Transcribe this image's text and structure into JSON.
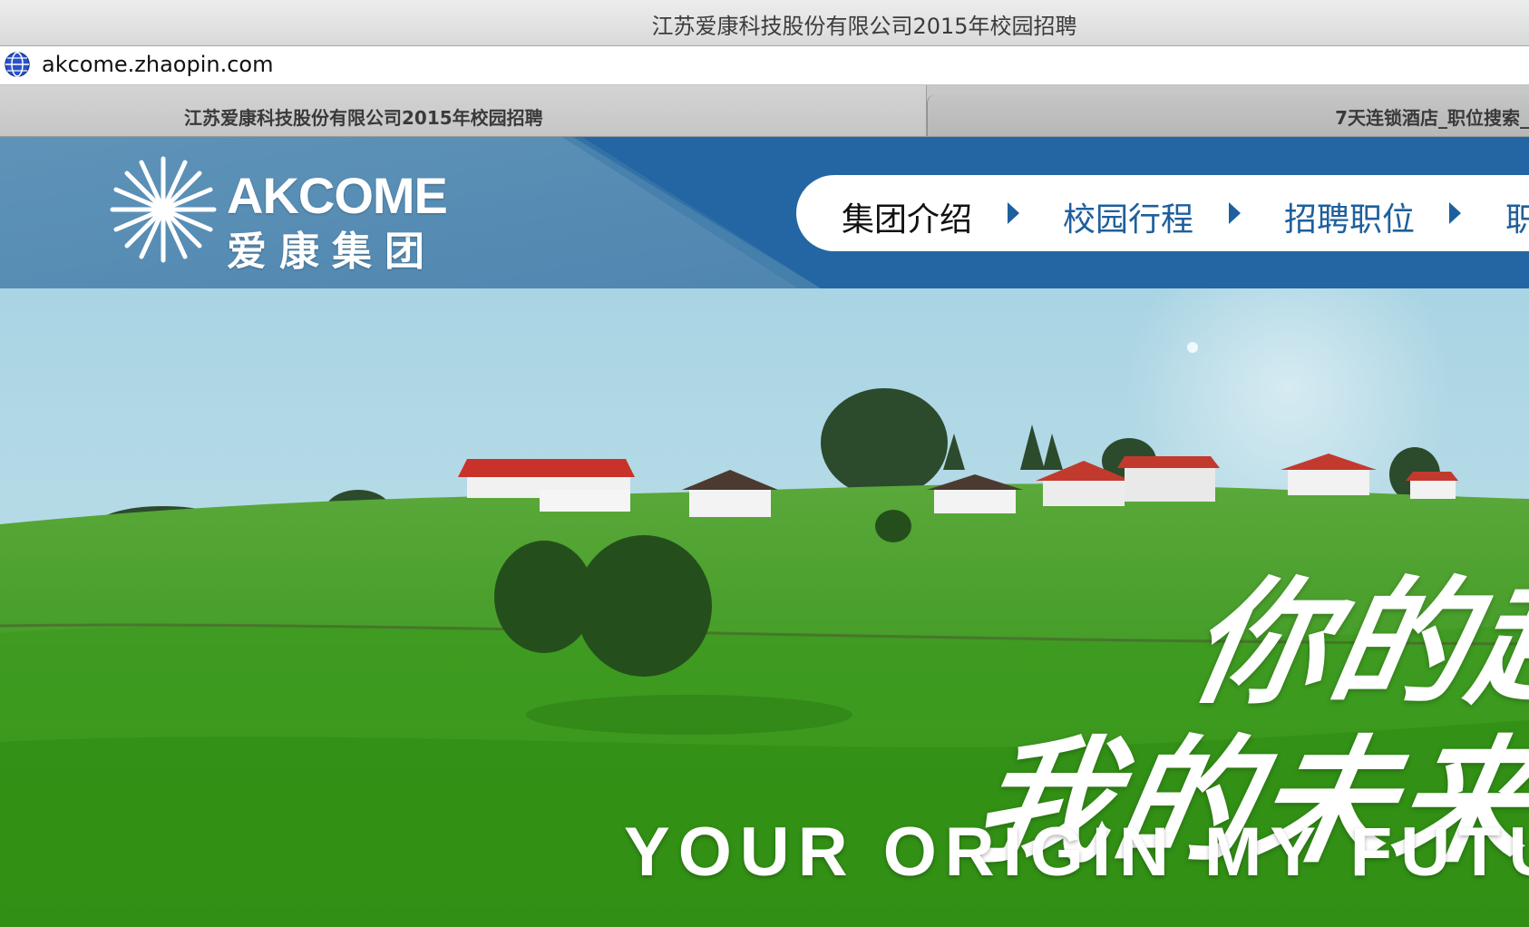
{
  "window": {
    "title": "江苏爱康科技股份有限公司2015年校园招聘"
  },
  "address_bar": {
    "url": "akcome.zhaopin.com",
    "site_icon": "globe-icon"
  },
  "tabs": [
    {
      "label": "江苏爱康科技股份有限公司2015年校园招聘",
      "active": true
    },
    {
      "label": "7天连锁酒店_职位搜索_",
      "active": false
    }
  ],
  "site": {
    "logo": {
      "english": "AKCOME",
      "chinese": "爱康集团",
      "icon": "snowflake-star-logo"
    },
    "nav": [
      {
        "label": "集团介绍",
        "active": true
      },
      {
        "label": "校园行程",
        "active": false
      },
      {
        "label": "招聘职位",
        "active": false
      },
      {
        "label": "职",
        "active": false
      }
    ],
    "nav_arrow_icon": "triangle-right-icon",
    "colors": {
      "header_blue": "#2466a3",
      "nav_text_blue": "#1e5f9c",
      "grass": "#3f9b22",
      "sky": "#bcdde8"
    }
  },
  "hero": {
    "slogan_line_1": "你的起",
    "slogan_line_2": "我的未来",
    "slogan_english": "YOUR ORIGIN  MY FUTURE"
  }
}
